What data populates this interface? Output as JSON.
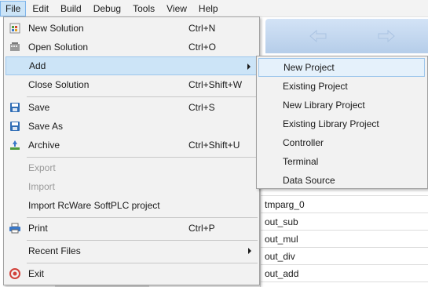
{
  "menubar": {
    "items": [
      {
        "label": "File"
      },
      {
        "label": "Edit"
      },
      {
        "label": "Build"
      },
      {
        "label": "Debug"
      },
      {
        "label": "Tools"
      },
      {
        "label": "View"
      },
      {
        "label": "Help"
      }
    ]
  },
  "file_menu": {
    "items": [
      {
        "label": "New Solution",
        "shortcut": "Ctrl+N",
        "icon": "new-solution-icon"
      },
      {
        "label": "Open Solution",
        "shortcut": "Ctrl+O",
        "icon": "open-solution-icon"
      },
      {
        "label": "Add",
        "shortcut": "",
        "has_submenu": true
      },
      {
        "label": "Close Solution",
        "shortcut": "Ctrl+Shift+W"
      },
      {
        "label": "Save",
        "shortcut": "Ctrl+S",
        "icon": "save-icon"
      },
      {
        "label": "Save As",
        "shortcut": "",
        "icon": "save-as-icon"
      },
      {
        "label": "Archive",
        "shortcut": "Ctrl+Shift+U",
        "icon": "archive-icon"
      },
      {
        "label": "Export",
        "shortcut": "",
        "disabled": true
      },
      {
        "label": "Import",
        "shortcut": "",
        "disabled": true
      },
      {
        "label": "Import RcWare SoftPLC project",
        "shortcut": ""
      },
      {
        "label": "Print",
        "shortcut": "Ctrl+P",
        "icon": "print-icon"
      },
      {
        "label": "Recent Files",
        "shortcut": "",
        "has_submenu": true
      },
      {
        "label": "Exit",
        "shortcut": "",
        "icon": "exit-icon"
      }
    ]
  },
  "add_submenu": {
    "items": [
      {
        "label": "New Project"
      },
      {
        "label": "Existing Project"
      },
      {
        "label": "New Library Project"
      },
      {
        "label": "Existing Library Project"
      },
      {
        "label": "Controller"
      },
      {
        "label": "Terminal"
      },
      {
        "label": "Data Source"
      }
    ]
  },
  "background_list": {
    "rows": [
      "tmparg_0",
      "out_sub",
      "out_mul",
      "out_div",
      "out_add"
    ]
  },
  "colors": {
    "menu_bg": "#f2f2f2",
    "highlight": "#cce4f7",
    "highlight_border": "#9dc6ec",
    "disabled_text": "#9a9a9a"
  }
}
